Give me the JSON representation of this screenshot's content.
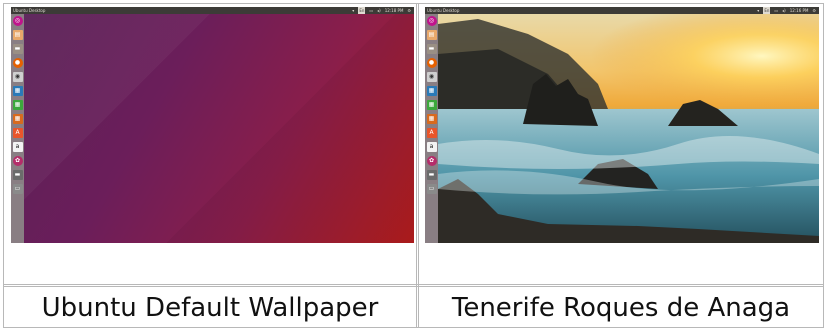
{
  "left_screenshot": {
    "window_title": "Ubuntu Desktop",
    "clock": "12:18 PM",
    "caption": "Ubuntu Default Wallpaper"
  },
  "right_screenshot": {
    "window_title": "Ubuntu Desktop",
    "clock": "12:16 PM",
    "caption": "Tenerife Roques de Anaga"
  },
  "launcher_icons": [
    "dash-icon",
    "files-icon",
    "file-manager-icon",
    "firefox-icon",
    "screenshot-icon",
    "writer-icon",
    "calc-icon",
    "impress-icon",
    "software-center-icon",
    "amazon-icon",
    "settings-icon",
    "drive-icon",
    "trash-icon"
  ],
  "colors": {
    "topbar": "#3c3b37",
    "ubuntu_purple": "#5a2157",
    "ubuntu_red": "#b31c1c"
  }
}
